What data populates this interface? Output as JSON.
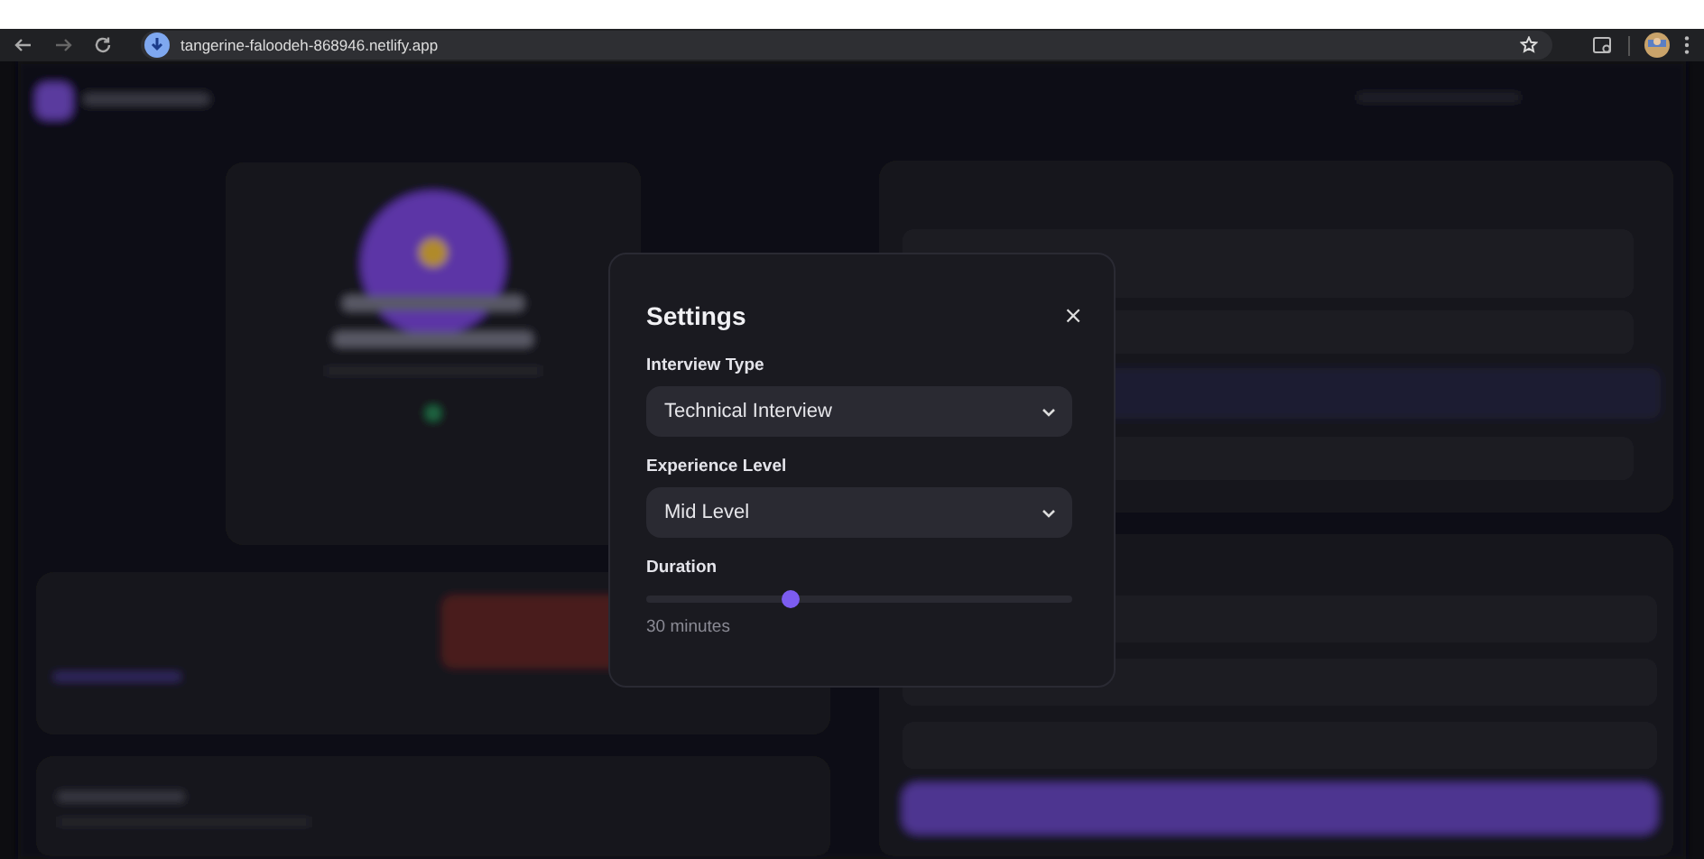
{
  "browser": {
    "url": "tangerine-faloodeh-868946.netlify.app"
  },
  "modal": {
    "title": "Settings",
    "close": "×",
    "fields": [
      {
        "kind": "select",
        "label": "Interview Type",
        "value": "Technical Interview"
      },
      {
        "kind": "select",
        "label": "Experience Level",
        "value": "Mid Level"
      },
      {
        "kind": "slider",
        "label": "Duration",
        "level": 0.34,
        "reading": "30 minutes"
      }
    ]
  }
}
